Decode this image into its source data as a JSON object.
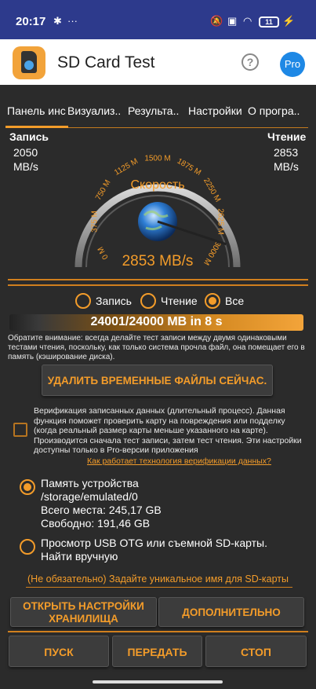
{
  "status": {
    "time": "20:17",
    "battery": "11"
  },
  "app": {
    "title": "SD Card Test",
    "help_label": "?",
    "pro_label": "Pro"
  },
  "tabs": [
    {
      "label": "Панель инс"
    },
    {
      "label": "Визуализ.."
    },
    {
      "label": "Результа.."
    },
    {
      "label": "Настройки"
    },
    {
      "label": "О програ.."
    }
  ],
  "stats": {
    "write_title": "Запись",
    "write_value": "2050",
    "write_unit": "MB/s",
    "read_title": "Чтение",
    "read_value": "2853",
    "read_unit": "MB/s"
  },
  "gauge": {
    "label": "Скорость",
    "value": "2853 MB/s",
    "ticks": [
      "0 M",
      "375 M",
      "750 M",
      "1125 M",
      "1500 M",
      "1875 M",
      "2250 M",
      "2625 M",
      "3000 M"
    ],
    "needle_value": 2853,
    "max": 3000
  },
  "modes": {
    "write": "Запись",
    "read": "Чтение",
    "all": "Все",
    "selected": "all"
  },
  "progress": {
    "text": "24001/24000 MB in 8 s",
    "fraction": 1.0
  },
  "note": "Обратите внимание: всегда делайте тест записи между двумя одинаковыми тестами чтения, поскольку, как только система прочла файл, она помещает его в память (кэширование диска).",
  "delete_button": "УДАЛИТЬ ВРЕМЕННЫЕ ФАЙЛЫ СЕЙЧАС.",
  "verify": {
    "text": "Верификация записанных данных (длительный процесс). Данная функция поможет проверить карту на повреждения или подделку (когда реальный размер карты меньше указанного на карте). Производится сначала тест записи, затем тест чтения. Эти настройки доступны только в Pro-версии приложения",
    "link": "Как работает технология верификации данных?"
  },
  "storage": {
    "device_title": "Память устройства",
    "device_path": "/storage/emulated/0",
    "device_total": "Всего места: 245,17 GB",
    "device_free": "Свободно: 191,46 GB",
    "usb_line1": "Просмотр USB OTG или съемной SD-карты.",
    "usb_line2": "Найти вручную",
    "optional_name": "(Не обязательно) Задайте уникальное имя для SD-карты"
  },
  "buttons": {
    "open_storage_1": "ОТКРЫТЬ НАСТРОЙКИ",
    "open_storage_2": "ХРАНИЛИЩА",
    "advanced": "ДОПОЛНИТЕЛЬНО",
    "start": "ПУСК",
    "share": "ПЕРЕДАТЬ",
    "stop": "СТОП"
  }
}
